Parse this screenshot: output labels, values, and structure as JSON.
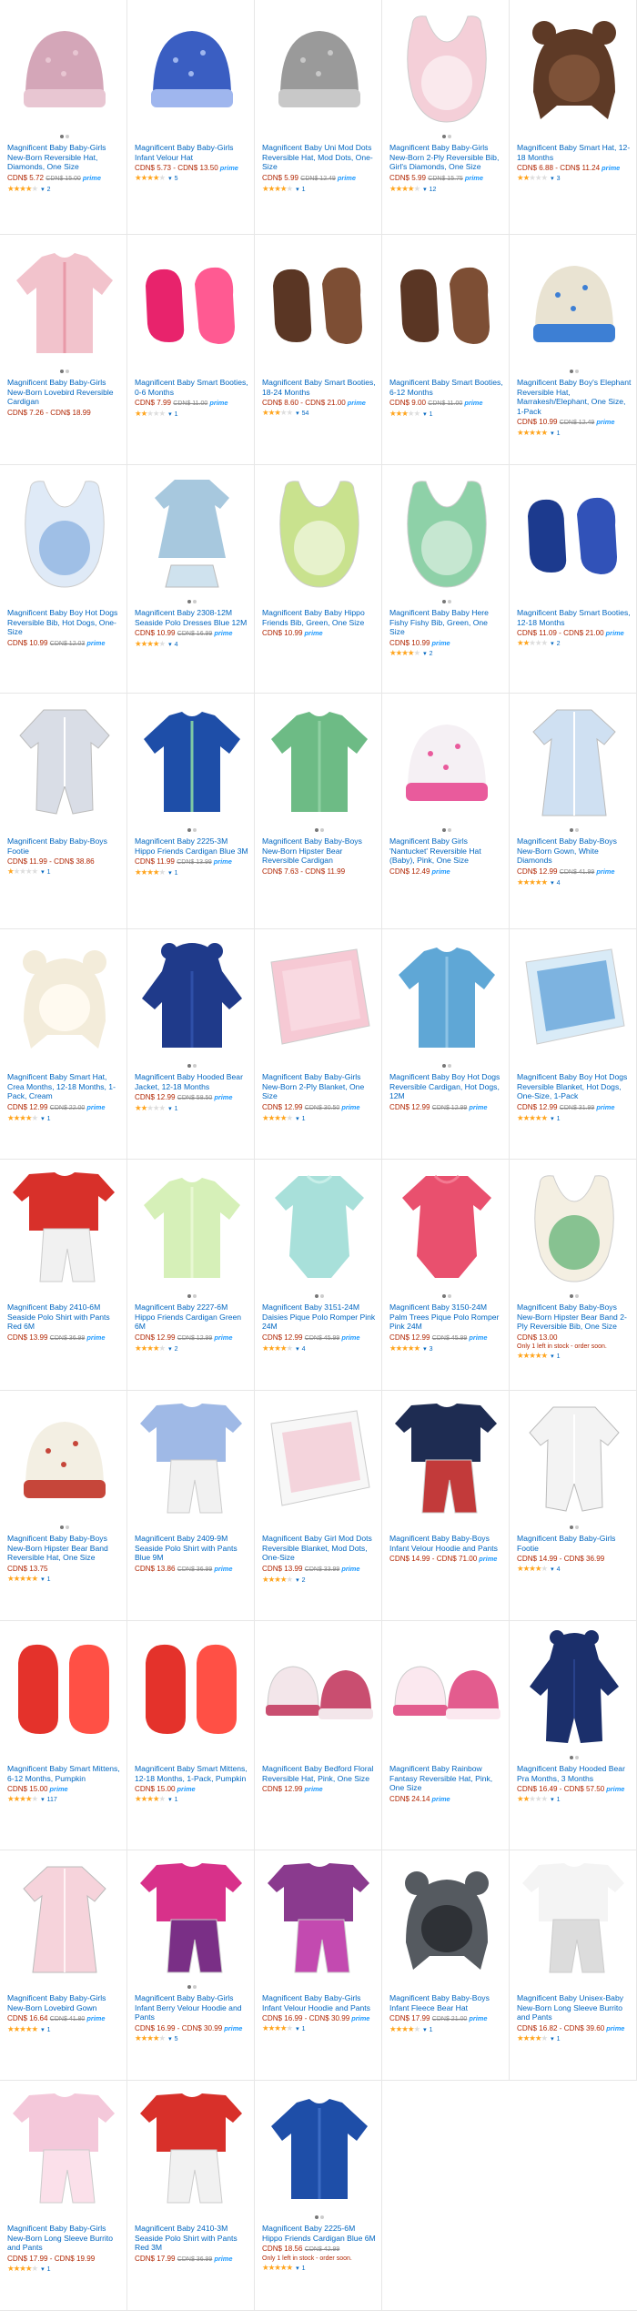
{
  "colors": {
    "link": "#0066c0",
    "price": "#b12704",
    "prime": "#1a98ff",
    "star": "#ffa41c"
  },
  "prime_label": "prime",
  "products": [
    {
      "title": "Magnificent Baby Baby-Girls New-Born Reversible Hat, Diamonds, One Size",
      "price": "CDN$ 5.72",
      "list": "CDN$ 15.00",
      "prime": true,
      "rating": 4,
      "reviews": "2",
      "art": "hat",
      "colors": [
        "#d4a6b8",
        "#e8c6d2"
      ],
      "dots": 2
    },
    {
      "title": "Magnificent Baby Baby-Girls Infant Velour Hat",
      "price": "CDN$ 5.73 - CDN$ 13.50",
      "prime": true,
      "rating": 4,
      "reviews": "5",
      "art": "hat",
      "colors": [
        "#3a5ec2",
        "#9fb6ee"
      ],
      "dots": 0
    },
    {
      "title": "Magnificent Baby Uni Mod Dots Reversible Hat, Mod Dots, One-Size",
      "price": "CDN$ 5.99",
      "list": "CDN$ 12.49",
      "prime": true,
      "rating": 4,
      "reviews": "1",
      "art": "hat",
      "colors": [
        "#9a9a9a",
        "#c8c8c8"
      ],
      "dots": 0
    },
    {
      "title": "Magnificent Baby Baby-Girls New-Born 2-Ply Reversible Bib, Girl's Diamonds, One Size",
      "price": "CDN$ 5.99",
      "list": "CDN$ 15.75",
      "prime": true,
      "rating": 4,
      "reviews": "12",
      "art": "bib",
      "colors": [
        "#f4cfd8",
        "#ffffff"
      ],
      "dots": 2
    },
    {
      "title": "Magnificent Baby Smart Hat, 12-18 Months",
      "price": "CDN$ 6.88 - CDN$ 11.24",
      "prime": true,
      "rating": 2,
      "reviews": "3",
      "art": "bearhat",
      "colors": [
        "#5e3a26",
        "#7e5238"
      ],
      "dots": 0
    },
    {
      "title": "Magnificent Baby Baby-Girls New-Born Lovebird Reversible Cardigan",
      "price": "CDN$ 7.26 - CDN$ 18.99",
      "prime": false,
      "rating": 0,
      "reviews": "",
      "art": "shirt",
      "colors": [
        "#f2c3cc",
        "#e89aa8"
      ],
      "dots": 2
    },
    {
      "title": "Magnificent Baby Smart Booties, 0-6 Months",
      "price": "CDN$ 7.99",
      "list": "CDN$ 11.00",
      "prime": true,
      "rating": 2,
      "reviews": "1",
      "art": "booties",
      "colors": [
        "#e8236c",
        "#ff5a92"
      ],
      "dots": 0
    },
    {
      "title": "Magnificent Baby Smart Booties, 18-24 Months",
      "price": "CDN$ 8.60 - CDN$ 21.00",
      "prime": true,
      "rating": 3,
      "reviews": "54",
      "art": "booties",
      "colors": [
        "#5a3624",
        "#7d4e34"
      ],
      "dots": 0
    },
    {
      "title": "Magnificent Baby Smart Booties, 6-12 Months",
      "price": "CDN$ 9.00",
      "list": "CDN$ 11.00",
      "prime": true,
      "rating": 3,
      "reviews": "1",
      "art": "booties",
      "colors": [
        "#5a3624",
        "#7d4e34"
      ],
      "dots": 0
    },
    {
      "title": "Magnificent Baby Boy's Elephant Reversible Hat, Marrakesh/Elephant, One Size, 1-Pack",
      "price": "CDN$ 10.99",
      "list": "CDN$ 12.49",
      "prime": true,
      "rating": 5,
      "reviews": "1",
      "art": "hat",
      "colors": [
        "#e9e3d2",
        "#3d7fd4"
      ],
      "dots": 2
    },
    {
      "title": "Magnificent Baby Boy Hot Dogs Reversible Bib, Hot Dogs, One-Size",
      "price": "CDN$ 10.99",
      "list": "CDN$ 12.03",
      "prime": true,
      "rating": 0,
      "reviews": "",
      "art": "bib",
      "colors": [
        "#dfeaf7",
        "#6a9bd8"
      ],
      "dots": 0
    },
    {
      "title": "Magnificent Baby 2308-12M Seaside Polo Dresses Blue 12M",
      "price": "CDN$ 10.99",
      "list": "CDN$ 16.99",
      "prime": true,
      "rating": 4,
      "reviews": "4",
      "art": "dress",
      "colors": [
        "#a7c8de",
        "#cfe2ee"
      ],
      "dots": 2
    },
    {
      "title": "Magnificent Baby Baby Hippo Friends Bib, Green, One Size",
      "price": "CDN$ 10.99",
      "prime": true,
      "rating": 0,
      "reviews": "",
      "art": "bib",
      "colors": [
        "#c9e28e",
        "#ffffff"
      ],
      "dots": 0
    },
    {
      "title": "Magnificent Baby Baby Here Fishy Fishy Bib, Green, One Size",
      "price": "CDN$ 10.99",
      "prime": true,
      "rating": 4,
      "reviews": "2",
      "art": "bib",
      "colors": [
        "#8ed1a8",
        "#f4f9f2"
      ],
      "dots": 2
    },
    {
      "title": "Magnificent Baby Smart Booties, 12-18 Months",
      "price": "CDN$ 11.09 - CDN$ 21.00",
      "prime": true,
      "rating": 2,
      "reviews": "2",
      "art": "booties",
      "colors": [
        "#1c3a8e",
        "#3152b8"
      ],
      "dots": 0
    },
    {
      "title": "Magnificent Baby Baby-Boys Footie",
      "price": "CDN$ 11.99 - CDN$ 38.86",
      "prime": false,
      "rating": 1,
      "reviews": "1",
      "art": "footie",
      "colors": [
        "#d9dde6",
        "#ffffff"
      ],
      "dots": 0
    },
    {
      "title": "Magnificent Baby 2225-3M Hippo Friends Cardigan Blue 3M",
      "price": "CDN$ 11.99",
      "list": "CDN$ 13.99",
      "prime": true,
      "rating": 4,
      "reviews": "1",
      "art": "shirt",
      "colors": [
        "#1e4ea8",
        "#7fc9a4"
      ],
      "dots": 2
    },
    {
      "title": "Magnificent Baby Baby-Boys New-Born Hipster Bear Reversible Cardigan",
      "price": "CDN$ 7.63 - CDN$ 11.99",
      "prime": false,
      "rating": 0,
      "reviews": "",
      "art": "shirt",
      "colors": [
        "#6dbb85",
        "#8fd0a2"
      ],
      "dots": 2
    },
    {
      "title": "Magnificent Baby Girls 'Nantucket' Reversible Hat (Baby), Pink, One Size",
      "price": "CDN$ 12.49",
      "prime": true,
      "rating": 0,
      "reviews": "",
      "art": "hat",
      "colors": [
        "#f5f0f4",
        "#e95b9c"
      ],
      "dots": 2
    },
    {
      "title": "Magnificent Baby Baby-Boys New-Born Gown, White Diamonds",
      "price": "CDN$ 12.99",
      "list": "CDN$ 41.99",
      "prime": true,
      "rating": 5,
      "reviews": "4",
      "art": "gown",
      "colors": [
        "#cfe0f2",
        "#ffffff"
      ],
      "dots": 2
    },
    {
      "title": "Magnificent Baby Smart Hat, Crea Months, 12-18 Months, 1-Pack, Cream",
      "price": "CDN$ 12.99",
      "list": "CDN$ 22.00",
      "prime": true,
      "rating": 4,
      "reviews": "1",
      "art": "bearhat",
      "colors": [
        "#f3ecda",
        "#fffaf0"
      ],
      "dots": 0
    },
    {
      "title": "Magnificent Baby Hooded Bear Jacket, 12-18 Months",
      "price": "CDN$ 12.99",
      "list": "CDN$ 58.50",
      "prime": true,
      "rating": 2,
      "reviews": "1",
      "art": "jacket",
      "colors": [
        "#1f3a8a",
        "#2e4fa8"
      ],
      "dots": 2
    },
    {
      "title": "Magnificent Baby Baby-Girls New-Born 2-Ply Blanket, One Size",
      "price": "CDN$ 12.99",
      "list": "CDN$ 30.50",
      "prime": true,
      "rating": 4,
      "reviews": "1",
      "art": "blanket",
      "colors": [
        "#f6c9d4",
        "#fbe4ea"
      ],
      "dots": 0
    },
    {
      "title": "Magnificent Baby Boy Hot Dogs Reversible Cardigan, Hot Dogs, 12M",
      "price": "CDN$ 12.99",
      "list": "CDN$ 12.99",
      "prime": true,
      "rating": 0,
      "reviews": "",
      "art": "shirt",
      "colors": [
        "#5fa7d6",
        "#8cc3e6"
      ],
      "dots": 2
    },
    {
      "title": "Magnificent Baby Boy Hot Dogs Reversible Blanket, Hot Dogs, One-Size, 1-Pack",
      "price": "CDN$ 12.99",
      "list": "CDN$ 31.99",
      "prime": true,
      "rating": 5,
      "reviews": "1",
      "art": "blanket",
      "colors": [
        "#d9ebf7",
        "#3f8ed0"
      ],
      "dots": 0
    },
    {
      "title": "Magnificent Baby 2410-6M Seaside Polo Shirt with Pants Red 6M",
      "price": "CDN$ 13.99",
      "list": "CDN$ 36.99",
      "prime": true,
      "rating": 0,
      "reviews": "",
      "art": "set",
      "colors": [
        "#d8302a",
        "#f1f1f1"
      ],
      "dots": 0
    },
    {
      "title": "Magnificent Baby 2227-6M Hippo Friends Cardigan Green 6M",
      "price": "CDN$ 12.99",
      "list": "CDN$ 12.99",
      "prime": true,
      "rating": 4,
      "reviews": "2",
      "art": "shirt",
      "colors": [
        "#d6f0b8",
        "#e8f8d2"
      ],
      "dots": 2
    },
    {
      "title": "Magnificent Baby 3151-24M Daisies Pique Polo Romper Pink 24M",
      "price": "CDN$ 12.99",
      "list": "CDN$ 45.99",
      "prime": true,
      "rating": 4,
      "reviews": "4",
      "art": "romper",
      "colors": [
        "#a8e0da",
        "#c8efe9"
      ],
      "dots": 2
    },
    {
      "title": "Magnificent Baby 3150-24M Palm Trees Pique Polo Romper Pink 24M",
      "price": "CDN$ 12.99",
      "list": "CDN$ 45.99",
      "prime": true,
      "rating": 5,
      "reviews": "3",
      "art": "romper",
      "colors": [
        "#e9506e",
        "#f47a92"
      ],
      "dots": 2
    },
    {
      "title": "Magnificent Baby Baby-Boys New-Born Hipster Bear Band 2-Ply Reversible Bib, One Size",
      "price": "CDN$ 13.00",
      "prime": false,
      "note": "Only 1 left in stock - order soon.",
      "rating": 5,
      "reviews": "1",
      "art": "bib",
      "colors": [
        "#f4efe2",
        "#2e9d4e"
      ],
      "dots": 2
    },
    {
      "title": "Magnificent Baby Baby-Boys New-Born Hipster Bear Band Reversible Hat, One Size",
      "price": "CDN$ 13.75",
      "prime": false,
      "rating": 5,
      "reviews": "1",
      "art": "hat",
      "colors": [
        "#f3efe3",
        "#c6463a"
      ],
      "dots": 2
    },
    {
      "title": "Magnificent Baby 2409-9M Seaside Polo Shirt with Pants Blue 9M",
      "price": "CDN$ 13.86",
      "list": "CDN$ 36.99",
      "prime": true,
      "rating": 0,
      "reviews": "",
      "art": "set",
      "colors": [
        "#9fb9e6",
        "#f1f1f1"
      ],
      "dots": 0
    },
    {
      "title": "Magnificent Baby Girl Mod Dots Reversible Blanket, Mod Dots, One-Size",
      "price": "CDN$ 13.99",
      "list": "CDN$ 33.99",
      "prime": true,
      "rating": 4,
      "reviews": "2",
      "art": "blanket",
      "colors": [
        "#f7f7f7",
        "#f2bcc9"
      ],
      "dots": 0
    },
    {
      "title": "Magnificent Baby Baby-Boys Infant Velour Hoodie and Pants",
      "price": "CDN$ 14.99 - CDN$ 71.00",
      "prime": true,
      "rating": 0,
      "reviews": "",
      "art": "set",
      "colors": [
        "#1e2c52",
        "#c23a3a"
      ],
      "dots": 0
    },
    {
      "title": "Magnificent Baby Baby-Girls Footie",
      "price": "CDN$ 14.99 - CDN$ 36.99",
      "prime": false,
      "rating": 4,
      "reviews": "4",
      "art": "footie",
      "colors": [
        "#f3f3f3",
        "#ffffff"
      ],
      "dots": 2
    },
    {
      "title": "Magnificent Baby Smart Mittens, 6-12 Months, Pumpkin",
      "price": "CDN$ 15.00",
      "prime": true,
      "rating": 4,
      "reviews": "117",
      "art": "mittens",
      "colors": [
        "#e4322b",
        "#ff5045"
      ],
      "dots": 0
    },
    {
      "title": "Magnificent Baby Smart Mittens, 12-18 Months, 1-Pack, Pumpkin",
      "price": "CDN$ 15.00",
      "prime": true,
      "rating": 4,
      "reviews": "1",
      "art": "mittens",
      "colors": [
        "#e4322b",
        "#ff5045"
      ],
      "dots": 0
    },
    {
      "title": "Magnificent Baby Bedford Floral Reversible Hat, Pink, One Size",
      "price": "CDN$ 12.99",
      "prime": true,
      "rating": 0,
      "reviews": "",
      "art": "twohats",
      "colors": [
        "#f3e6ea",
        "#c94e70"
      ],
      "dots": 0
    },
    {
      "title": "Magnificent Baby Rainbow Fantasy Reversible Hat, Pink, One Size",
      "price": "CDN$ 24.14",
      "prime": true,
      "rating": 0,
      "reviews": "",
      "art": "twohats",
      "colors": [
        "#fbe8ef",
        "#e35c8e"
      ],
      "dots": 0
    },
    {
      "title": "Magnificent Baby Hooded Bear Pra Months, 3 Months",
      "price": "CDN$ 16.49 - CDN$ 57.50",
      "prime": true,
      "rating": 2,
      "reviews": "1",
      "art": "snowsuit",
      "colors": [
        "#1b2f6b",
        "#29428c"
      ],
      "dots": 2
    },
    {
      "title": "Magnificent Baby Baby-Girls New-Born Lovebird Gown",
      "price": "CDN$ 16.64",
      "list": "CDN$ 41.80",
      "prime": true,
      "rating": 5,
      "reviews": "1",
      "art": "gown",
      "colors": [
        "#f6d3db",
        "#fff3f5"
      ],
      "dots": 0
    },
    {
      "title": "Magnificent Baby Baby-Girls Infant Berry Velour Hoodie and Pants",
      "price": "CDN$ 16.99 - CDN$ 30.99",
      "prime": true,
      "rating": 4,
      "reviews": "5",
      "art": "set",
      "colors": [
        "#d8318a",
        "#7a2f86"
      ],
      "dots": 2
    },
    {
      "title": "Magnificent Baby Baby-Girls Infant Velour Hoodie and Pants",
      "price": "CDN$ 16.99 - CDN$ 30.99",
      "prime": true,
      "rating": 4,
      "reviews": "1",
      "art": "set",
      "colors": [
        "#8a3a8e",
        "#c34ab0"
      ],
      "dots": 0
    },
    {
      "title": "Magnificent Baby Baby-Boys Infant Fleece Bear Hat",
      "price": "CDN$ 17.99",
      "list": "CDN$ 21.00",
      "prime": true,
      "rating": 4,
      "reviews": "1",
      "art": "bearhat",
      "colors": [
        "#555a60",
        "#2e3136"
      ],
      "dots": 0
    },
    {
      "title": "Magnificent Baby Unisex-Baby New-Born Long Sleeve Burrito and Pants",
      "price": "CDN$ 16.82 - CDN$ 39.60",
      "prime": true,
      "rating": 4,
      "reviews": "1",
      "art": "set",
      "colors": [
        "#f4f4f4",
        "#dcdcdc"
      ],
      "dots": 0
    },
    {
      "title": "Magnificent Baby Baby-Girls New-Born Long Sleeve Burrito and Pants",
      "price": "CDN$ 17.99 - CDN$ 19.99",
      "prime": false,
      "rating": 4,
      "reviews": "1",
      "art": "set",
      "colors": [
        "#f4c8da",
        "#fbe0ea"
      ],
      "dots": 0
    },
    {
      "title": "Magnificent Baby 2410-3M Seaside Polo Shirt with Pants Red 3M",
      "price": "CDN$ 17.99",
      "list": "CDN$ 36.99",
      "prime": true,
      "rating": 0,
      "reviews": "",
      "art": "set",
      "colors": [
        "#d8302a",
        "#f1f1f1"
      ],
      "dots": 0
    },
    {
      "title": "Magnificent Baby 2225-6M Hippo Friends Cardigan Blue 6M",
      "price": "CDN$ 18.56",
      "list": "CDN$ 42.99",
      "prime": false,
      "note": "Only 1 left in stock - order soon.",
      "rating": 5,
      "reviews": "1",
      "art": "shirt",
      "colors": [
        "#1e4ea8",
        "#3b6bc4"
      ],
      "dots": 2
    }
  ]
}
